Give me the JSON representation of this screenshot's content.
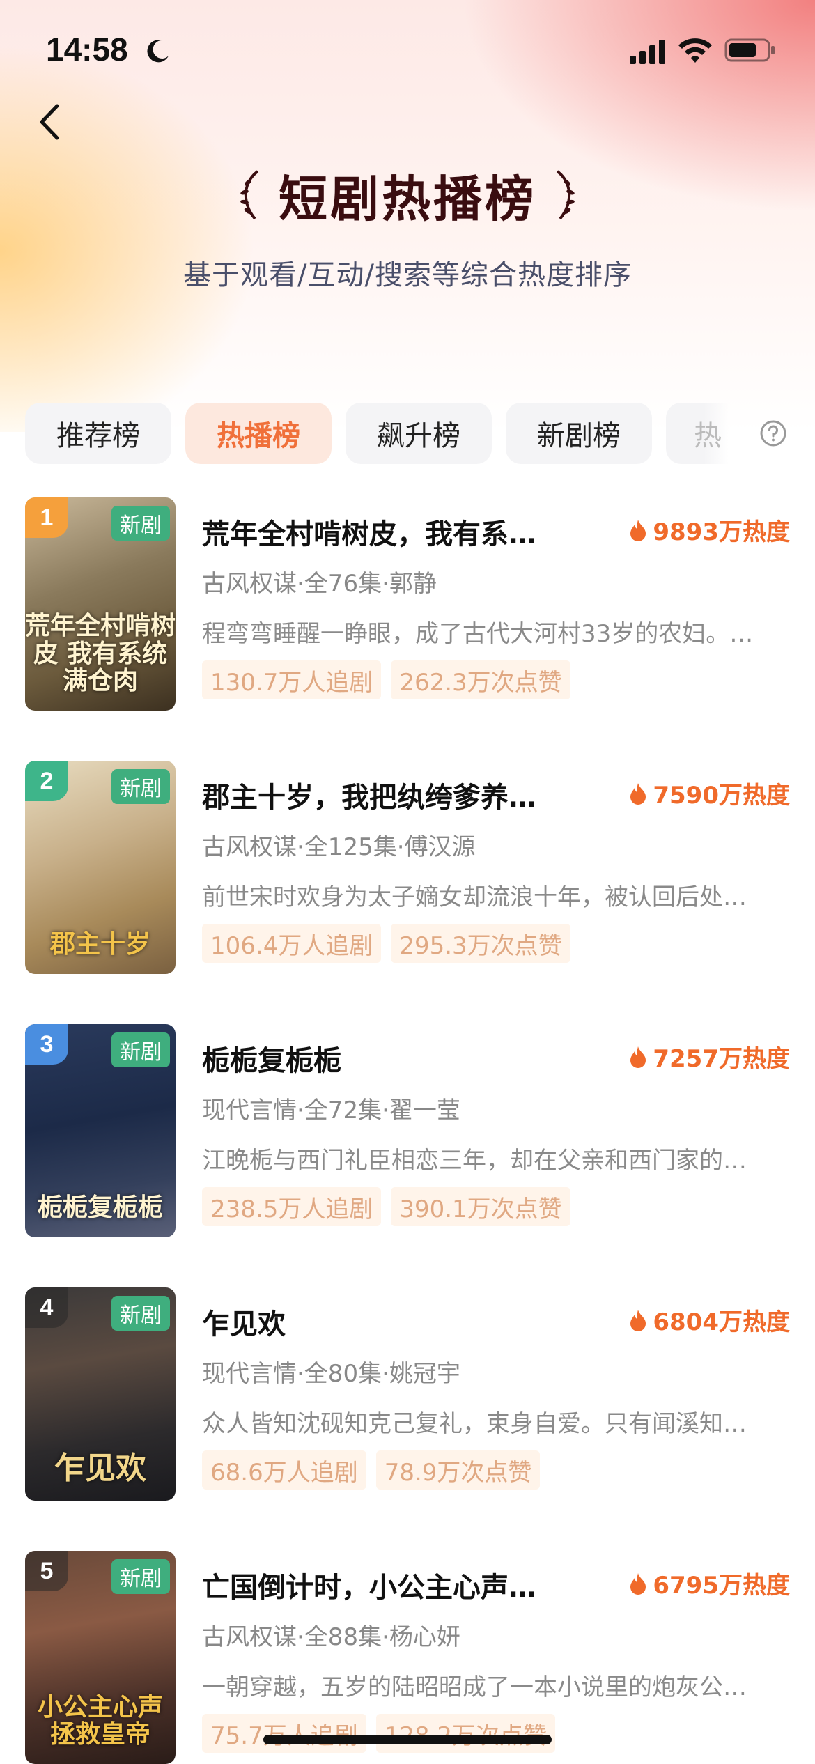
{
  "status_bar": {
    "time": "14:58"
  },
  "header": {
    "title": "短剧热播榜",
    "subtitle": "基于观看/互动/搜索等综合热度排序"
  },
  "tabs": [
    {
      "label": "推荐榜",
      "active": false
    },
    {
      "label": "热播榜",
      "active": true
    },
    {
      "label": "飙升榜",
      "active": false
    },
    {
      "label": "新剧榜",
      "active": false
    },
    {
      "label": "热",
      "active": false
    }
  ],
  "items": [
    {
      "rank": "1",
      "badge": "新剧",
      "poster_text": "荒年全村啃树皮 我有系统满仓肉",
      "title": "荒年全村啃树皮，我有系…",
      "heat": "9893万热度",
      "meta": "古风权谋·全76集·郭静",
      "desc": "程弯弯睡醒一睁眼，成了古代大河村33岁的农妇。…",
      "followers": "130.7万人追剧",
      "likes": "262.3万次点赞",
      "rank_color": "#f5a03c"
    },
    {
      "rank": "2",
      "badge": "新剧",
      "poster_text": "郡主十岁",
      "title": "郡主十岁，我把纨绔爹养…",
      "heat": "7590万热度",
      "meta": "古风权谋·全125集·傅汉源",
      "desc": "前世宋时欢身为太子嫡女却流浪十年，被认回后处…",
      "followers": "106.4万人追剧",
      "likes": "295.3万次点赞",
      "rank_color": "#3eb58a"
    },
    {
      "rank": "3",
      "badge": "新剧",
      "poster_text": "栀栀复栀栀",
      "title": "栀栀复栀栀",
      "heat": "7257万热度",
      "meta": "现代言情·全72集·翟一莹",
      "desc": "江晚栀与西门礼臣相恋三年，却在父亲和西门家的…",
      "followers": "238.5万人追剧",
      "likes": "390.1万次点赞",
      "rank_color": "#4a8ee0"
    },
    {
      "rank": "4",
      "badge": "新剧",
      "poster_text": "乍见欢",
      "title": "乍见欢",
      "heat": "6804万热度",
      "meta": "现代言情·全80集·姚冠宇",
      "desc": "众人皆知沈砚知克己复礼，束身自爱。只有闻溪知…",
      "followers": "68.6万人追剧",
      "likes": "78.9万次点赞",
      "rank_color": "rgba(40,40,40,0.55)"
    },
    {
      "rank": "5",
      "badge": "新剧",
      "poster_text": "小公主心声 拯救皇帝",
      "title": "亡国倒计时，小公主心声…",
      "heat": "6795万热度",
      "meta": "古风权谋·全88集·杨心妍",
      "desc": "一朝穿越，五岁的陆昭昭成了一本小说里的炮灰公…",
      "followers": "75.7万人追剧",
      "likes": "128.2万次点赞",
      "rank_color": "rgba(40,40,40,0.55)"
    }
  ],
  "colors": {
    "accent": "#f06a2a",
    "new_badge": "#3fae7e",
    "active_tab_bg": "#fde8de"
  },
  "icons": {
    "back": "chevron-left-icon",
    "help": "question-circle-icon",
    "heat": "fire-icon"
  }
}
